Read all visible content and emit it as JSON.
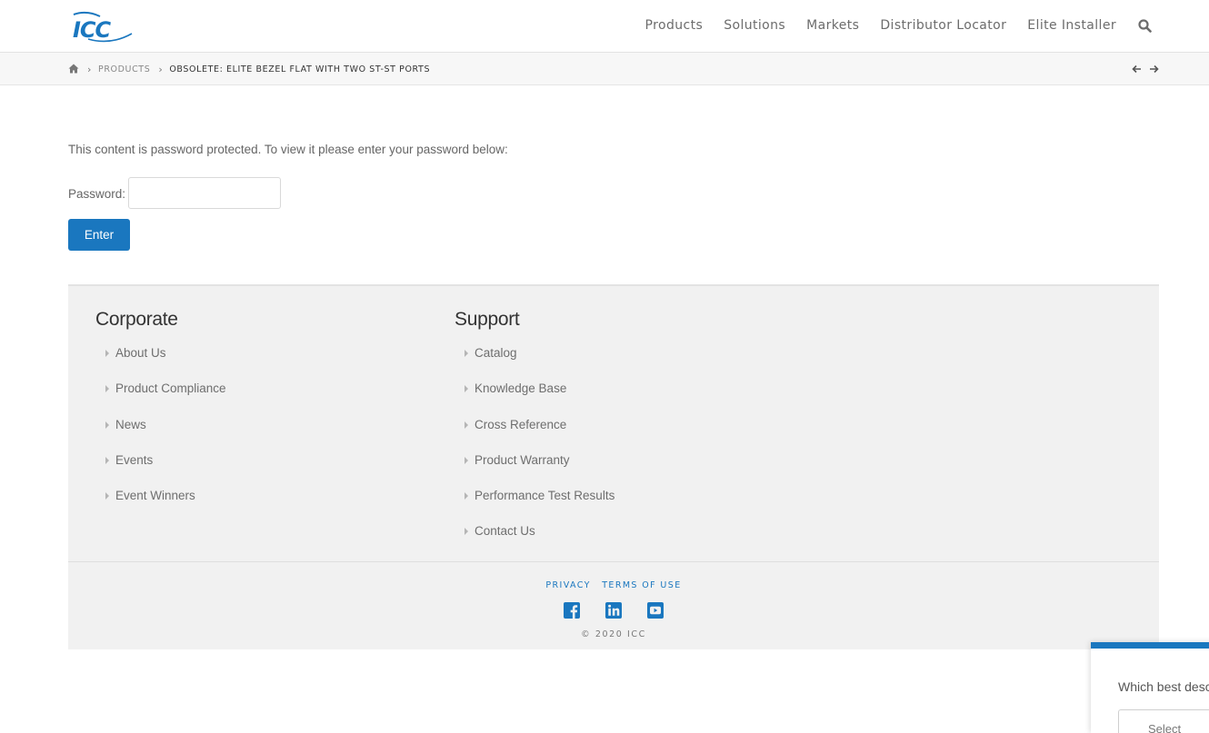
{
  "brand": {
    "logo_text": "ICC",
    "accent_color": "#1a77bf"
  },
  "nav": {
    "items": [
      "Products",
      "Solutions",
      "Markets",
      "Distributor Locator",
      "Elite Installer"
    ],
    "search_icon": "search-icon"
  },
  "breadcrumb": {
    "home_icon": "home-icon",
    "items": [
      "PRODUCTS",
      "OBSOLETE: ELITE BEZEL FLAT WITH TWO ST-ST PORTS"
    ],
    "prev_icon": "arrow-left-icon",
    "next_icon": "arrow-right-icon"
  },
  "password_form": {
    "prompt": "This content is password protected. To view it please enter your password below:",
    "label": "Password:",
    "value": "",
    "submit_label": "Enter"
  },
  "footer": {
    "corporate": {
      "title": "Corporate",
      "links": [
        "About Us",
        "Product Compliance",
        "News",
        "Events",
        "Event Winners"
      ]
    },
    "support": {
      "title": "Support",
      "links": [
        "Catalog",
        "Knowledge Base",
        "Cross Reference",
        "Product Warranty",
        "Performance Test Results",
        "Contact Us"
      ]
    },
    "legal": {
      "privacy": "PRIVACY",
      "terms": "TERMS OF USE"
    },
    "social_icons": [
      "facebook-icon",
      "linkedin-icon",
      "youtube-icon"
    ],
    "copyright": "© 2020 ICC"
  },
  "survey": {
    "question": "Which best desc",
    "select_value": "Select"
  }
}
